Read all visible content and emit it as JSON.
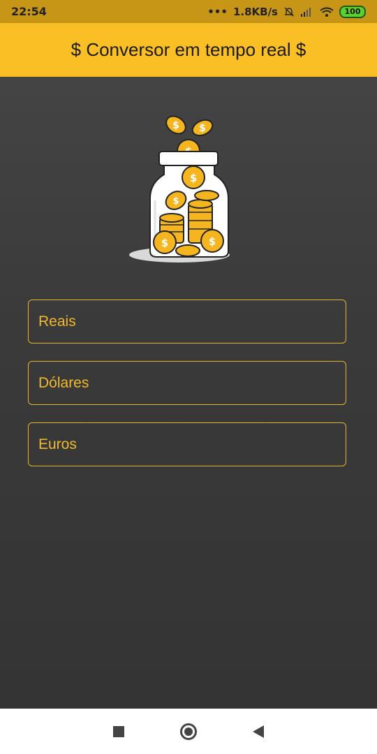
{
  "status_bar": {
    "time": "22:54",
    "network_speed": "1.8KB/s",
    "battery": "100",
    "icons": [
      "dots-icon",
      "bell-off-icon",
      "signal-icon",
      "wifi-icon",
      "battery-icon"
    ]
  },
  "app_bar": {
    "title": "$ Conversor em tempo real $"
  },
  "fields": [
    {
      "label": "Reais",
      "value": ""
    },
    {
      "label": "Dólares",
      "value": ""
    },
    {
      "label": "Euros",
      "value": ""
    }
  ],
  "nav_bar": {
    "icons": [
      "recent-apps-icon",
      "home-icon",
      "back-icon"
    ]
  },
  "colors": {
    "accent": "#fbbf26",
    "status_bar": "#c79617",
    "background": "#3a3a3a",
    "field_text": "#f3b92d"
  }
}
